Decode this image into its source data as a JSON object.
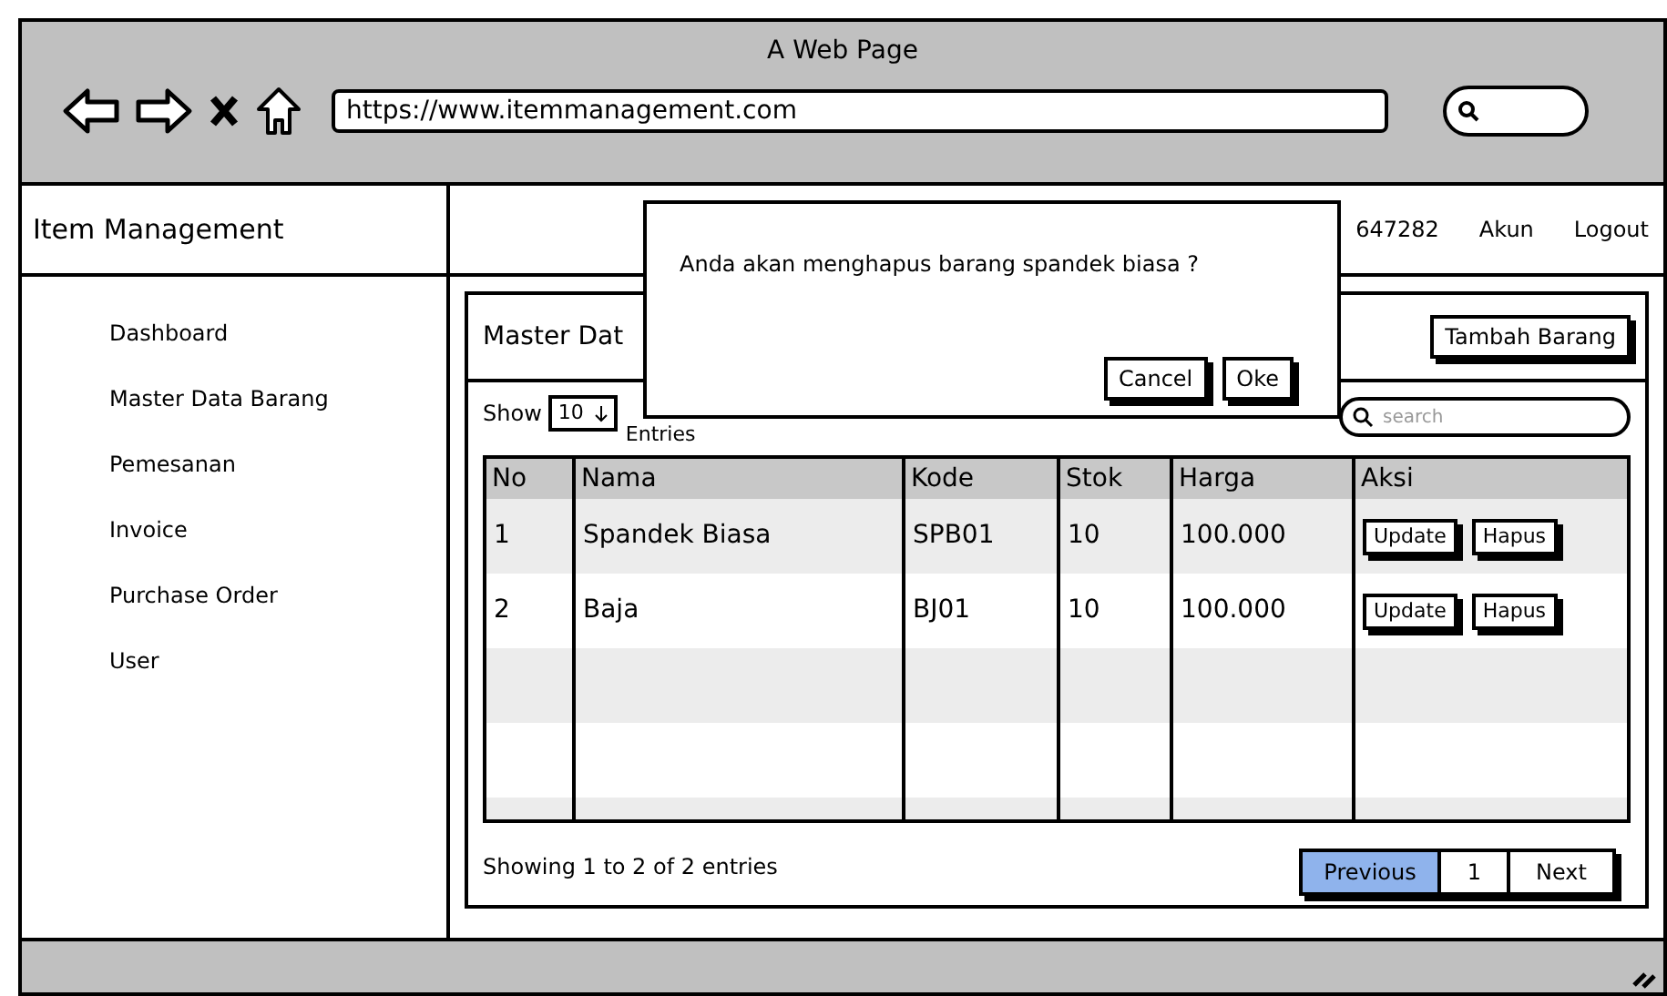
{
  "browser": {
    "title": "A Web Page",
    "url": "https://www.itemmanagement.com"
  },
  "sidebar": {
    "title": "Item Management",
    "items": [
      {
        "label": "Dashboard"
      },
      {
        "label": "Master Data Barang"
      },
      {
        "label": "Pemesanan"
      },
      {
        "label": "Invoice"
      },
      {
        "label": "Purchase Order"
      },
      {
        "label": "User"
      }
    ]
  },
  "header": {
    "phone": "647282",
    "links": [
      "Akun",
      "Logout"
    ]
  },
  "panel": {
    "title": "Master Dat",
    "add_button": "Tambah Barang",
    "show_label": "Show",
    "page_size": "10",
    "entries_label": "Entries",
    "search": {
      "placeholder": "search"
    }
  },
  "table": {
    "columns": [
      "No",
      "Nama",
      "Kode",
      "Stok",
      "Harga",
      "Aksi"
    ],
    "rows": [
      {
        "cells": [
          "1",
          "Spandek Biasa",
          "SPB01",
          "10",
          "100.000"
        ],
        "actions": [
          "Update",
          "Hapus"
        ]
      },
      {
        "cells": [
          "2",
          "Baja",
          "BJ01",
          "10",
          "100.000"
        ],
        "actions": [
          "Update",
          "Hapus"
        ]
      }
    ]
  },
  "footer": {
    "info": "Showing 1 to 2 of 2 entries",
    "pages": [
      {
        "label": "Previous",
        "selected": true
      },
      {
        "label": "1",
        "selected": false
      },
      {
        "label": "Next",
        "selected": false
      }
    ]
  },
  "dialog": {
    "message": "Anda akan menghapus barang spandek biasa ?",
    "buttons": [
      "Cancel",
      "Oke"
    ]
  }
}
